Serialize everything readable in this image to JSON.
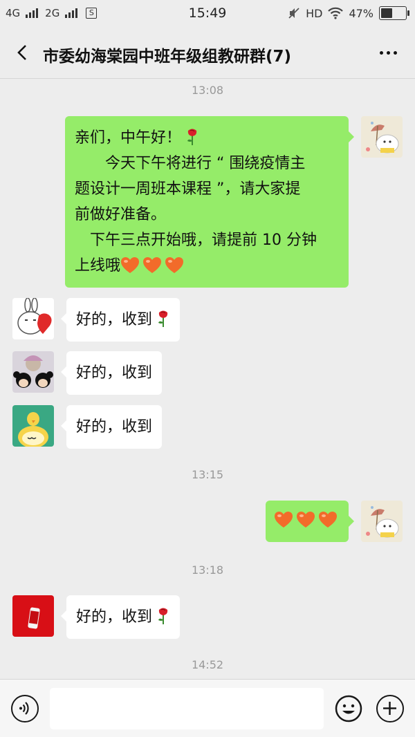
{
  "status_bar": {
    "sim1": "4G",
    "sim2": "2G",
    "sim_icon": "S",
    "time": "15:49",
    "network": "HD",
    "battery": "47%",
    "battery_level": 0.47,
    "icons": [
      "signal-bars-icon",
      "sim-card-icon",
      "mute-icon",
      "wifi-icon",
      "battery-icon"
    ]
  },
  "header": {
    "title": "市委幼海棠园中班年级组教研群(7)",
    "icons": [
      "back-arrow-icon",
      "more-dots-icon"
    ]
  },
  "messages": {
    "t1": "13:08",
    "m1": {
      "line1": "亲们，中午好！",
      "line2": "　　今天下午将进行 “ 围绕疫情主",
      "line3": "题设计一周班本课程 ”，请大家提",
      "line4": "前做好准备。",
      "line5": "　下午三点开始哦，请提前 10 分钟",
      "line6": "上线哦"
    },
    "m2": "好的，收到",
    "m3": "好的，收到",
    "m4": "好的，收到",
    "t2": "13:15",
    "t3": "13:18",
    "m6": "好的，收到",
    "t4": "14:52",
    "emoji_icons": [
      "rose-emoji-icon",
      "orange-heart-emoji-icon"
    ]
  },
  "input_bar": {
    "icons": [
      "voice-icon",
      "emoji-icon",
      "plus-icon"
    ]
  },
  "colors": {
    "background": "#ededed",
    "outgoing_bubble": "#95ec69",
    "incoming_bubble": "#ffffff",
    "timestamp": "#999999",
    "heart": "#f26b2a",
    "rose": "#d8202a"
  }
}
